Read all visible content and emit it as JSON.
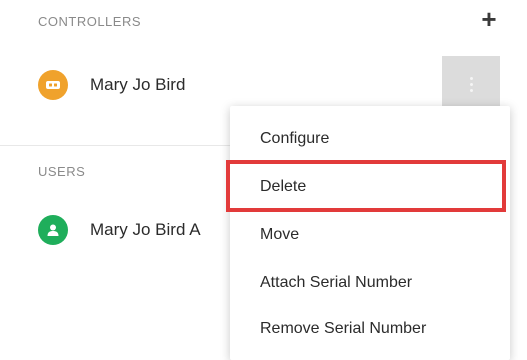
{
  "sections": {
    "controllers": "CONTROLLERS",
    "users": "USERS"
  },
  "add_icon": "plus-icon",
  "controller": {
    "name": "Mary Jo Bird",
    "avatar_icon": "controller-icon",
    "avatar_color": "#f0a22c"
  },
  "user": {
    "name": "Mary Jo Bird A",
    "avatar_icon": "user-icon",
    "avatar_color": "#1fae5b"
  },
  "kebab_icon": "more-vertical-icon",
  "menu": {
    "items": [
      {
        "label": "Configure"
      },
      {
        "label": "Delete"
      },
      {
        "label": "Move"
      },
      {
        "label": "Attach Serial Number"
      },
      {
        "label": "Remove Serial Number"
      }
    ]
  },
  "highlight_color": "#e23a3a"
}
